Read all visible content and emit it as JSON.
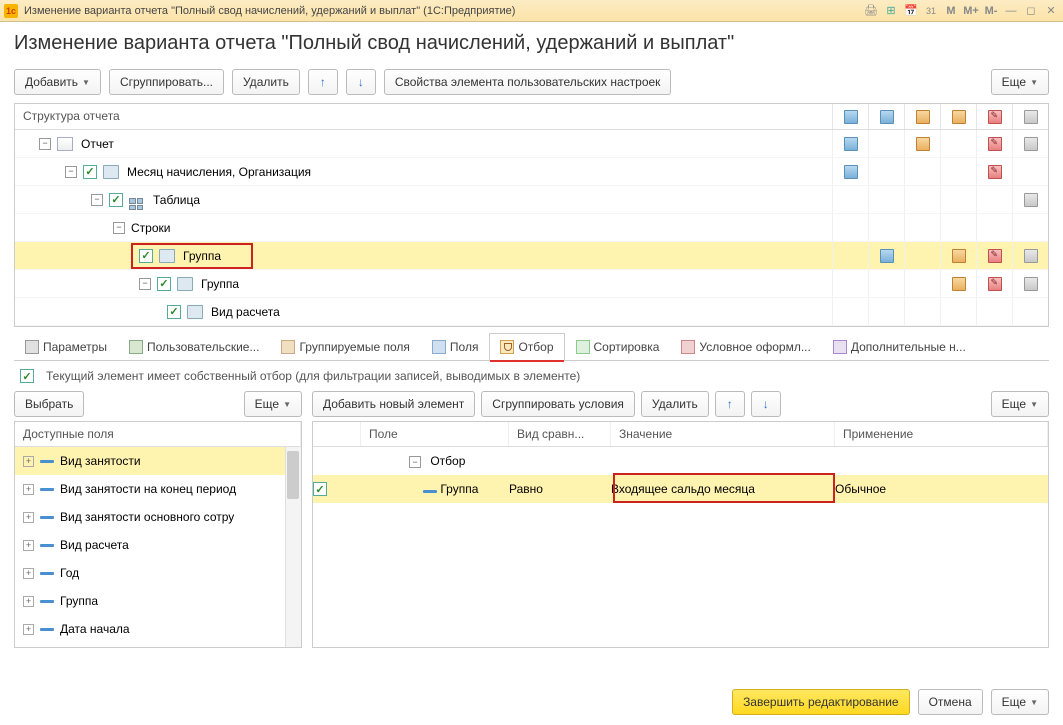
{
  "window": {
    "title": "Изменение варианта отчета \"Полный свод начислений, удержаний и выплат\"  (1С:Предприятие)",
    "sysicons": {
      "m": "M",
      "mplus": "M+",
      "mminus": "M-"
    }
  },
  "page": {
    "title": "Изменение варианта отчета \"Полный свод начислений, удержаний и выплат\""
  },
  "toolbar": {
    "add": "Добавить",
    "group": "Сгруппировать...",
    "delete": "Удалить",
    "props": "Свойства элемента пользовательских настроек",
    "more": "Еще"
  },
  "structure": {
    "header": "Структура отчета",
    "rows": [
      {
        "label": "Отчет",
        "indent": 0,
        "chk": false,
        "exp": true,
        "icon": "doc"
      },
      {
        "label": "Месяц начисления, Организация",
        "indent": 1,
        "chk": true,
        "exp": true,
        "icon": "grp"
      },
      {
        "label": "Таблица",
        "indent": 2,
        "chk": true,
        "exp": true,
        "icon": "tbl"
      },
      {
        "label": "Строки",
        "indent": 3,
        "chk": false,
        "exp": true,
        "icon": "none"
      },
      {
        "label": "Группа",
        "indent": 4,
        "chk": true,
        "exp": false,
        "icon": "grp",
        "highlight": true
      },
      {
        "label": "Группа",
        "indent": 5,
        "chk": true,
        "exp": true,
        "icon": "grp"
      },
      {
        "label": "Вид расчета",
        "indent": 6,
        "chk": true,
        "exp": false,
        "icon": "grp"
      }
    ]
  },
  "tabs": {
    "params": "Параметры",
    "user": "Пользовательские...",
    "group": "Группируемые поля",
    "fields": "Поля",
    "filter": "Отбор",
    "sort": "Сортировка",
    "cond": "Условное оформл...",
    "extra": "Дополнительные н..."
  },
  "filter_note": "Текущий элемент имеет собственный отбор (для фильтрации записей, выводимых в элементе)",
  "left_panel": {
    "select": "Выбрать",
    "more": "Еще",
    "header": "Доступные поля",
    "items": [
      "Вид занятости",
      "Вид занятости на конец период",
      "Вид занятости основного сотру",
      "Вид расчета",
      "Год",
      "Группа",
      "Дата начала"
    ]
  },
  "right_panel": {
    "add_item": "Добавить новый элемент",
    "group_cond": "Сгруппировать условия",
    "delete": "Удалить",
    "more": "Еще",
    "headers": {
      "field": "Поле",
      "compare": "Вид сравн...",
      "value": "Значение",
      "apply": "Применение"
    },
    "group_row": "Отбор",
    "row": {
      "field": "Группа",
      "compare": "Равно",
      "value": "Входящее сальдо месяца",
      "apply": "Обычное"
    }
  },
  "footer": {
    "finish": "Завершить редактирование",
    "cancel": "Отмена",
    "more": "Еще"
  }
}
